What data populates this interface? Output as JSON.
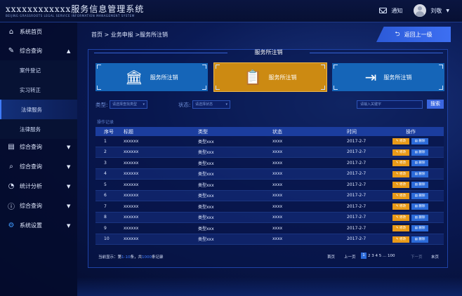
{
  "header": {
    "title": "xxxxxxxxxxxx服务信息管理系统",
    "subtitle": "BEIJING GRASSROOTS LEGAL SERVICE INFORMATION MANAGEMENT SYSTEM",
    "notice_label": "通知",
    "user_name": "刘敬"
  },
  "sidebar": {
    "items": [
      {
        "label": "系统首页",
        "icon": "home-icon"
      },
      {
        "label": "综合查询",
        "icon": "edit-icon",
        "arrow": "▲"
      },
      {
        "label": "综合查询",
        "icon": "document-icon",
        "arrow": "▼"
      },
      {
        "label": "综合查询",
        "icon": "search-doc-icon",
        "arrow": "▼"
      },
      {
        "label": "统计分析",
        "icon": "chart-icon",
        "arrow": "▼"
      },
      {
        "label": "综合查询",
        "icon": "alert-icon",
        "arrow": "▼"
      },
      {
        "label": "系统设置",
        "icon": "gear-icon",
        "arrow": "▼"
      }
    ],
    "sub_items": [
      {
        "label": "案件登记"
      },
      {
        "label": "实习转正"
      },
      {
        "label": "法律服务"
      },
      {
        "label": "法律服务"
      }
    ]
  },
  "breadcrumb": "首页 > 业务申报 >服务所注销",
  "back_label": "返回上一级",
  "panel_title": "服务所注销",
  "cards": [
    {
      "label": "服务所注销",
      "icon": "building-icon"
    },
    {
      "label": "服务所注销",
      "icon": "clipboard-icon"
    },
    {
      "label": "服务所注销",
      "icon": "exit-icon"
    }
  ],
  "filters": {
    "type_label": "类型:",
    "type_placeholder": "请选择查找类型",
    "status_label": "状态:",
    "status_placeholder": "请选择状态",
    "keyword_placeholder": "请输入关键字",
    "search_label": "搜索"
  },
  "table_caption": "操作记录",
  "table": {
    "headers": [
      "序号",
      "标题",
      "类型",
      "状态",
      "时间",
      "操作"
    ],
    "rows": [
      [
        "1",
        "xxxxxx",
        "类型xxx",
        "xxxx",
        "2017-2-7"
      ],
      [
        "2",
        "xxxxxx",
        "类型xxx",
        "xxxx",
        "2017-2-7"
      ],
      [
        "3",
        "xxxxxx",
        "类型xxx",
        "xxxx",
        "2017-2-7"
      ],
      [
        "4",
        "xxxxxx",
        "类型xxx",
        "xxxx",
        "2017-2-7"
      ],
      [
        "5",
        "xxxxxx",
        "类型xxx",
        "xxxx",
        "2017-2-7"
      ],
      [
        "6",
        "xxxxxx",
        "类型xxx",
        "xxxx",
        "2017-2-7"
      ],
      [
        "7",
        "xxxxxx",
        "类型xxx",
        "xxxx",
        "2017-2-7"
      ],
      [
        "8",
        "xxxxxx",
        "类型xxx",
        "xxxx",
        "2017-2-7"
      ],
      [
        "9",
        "xxxxxx",
        "类型xxx",
        "xxxx",
        "2017-2-7"
      ],
      [
        "10",
        "xxxxxx",
        "类型xxx",
        "xxxx",
        "2017-2-7"
      ]
    ],
    "edit_label": "✎ 修改",
    "delete_label": "▤ 删除"
  },
  "footer": {
    "prefix": "当前显示：第",
    "range": "1-10",
    "mid": "条，共",
    "total": "1000",
    "suffix": "条记录"
  },
  "pager": {
    "first": "首页",
    "prev": "上一页",
    "current": "1",
    "pages": "2 3 4 5 ... 100",
    "next": "下一页",
    "last": "末页"
  },
  "colors": {
    "accent": "#3f7bff",
    "card_blue": "#1565b8",
    "card_orange": "#cc8a12",
    "edit": "#e89a18",
    "delete": "#2c6bd9"
  }
}
